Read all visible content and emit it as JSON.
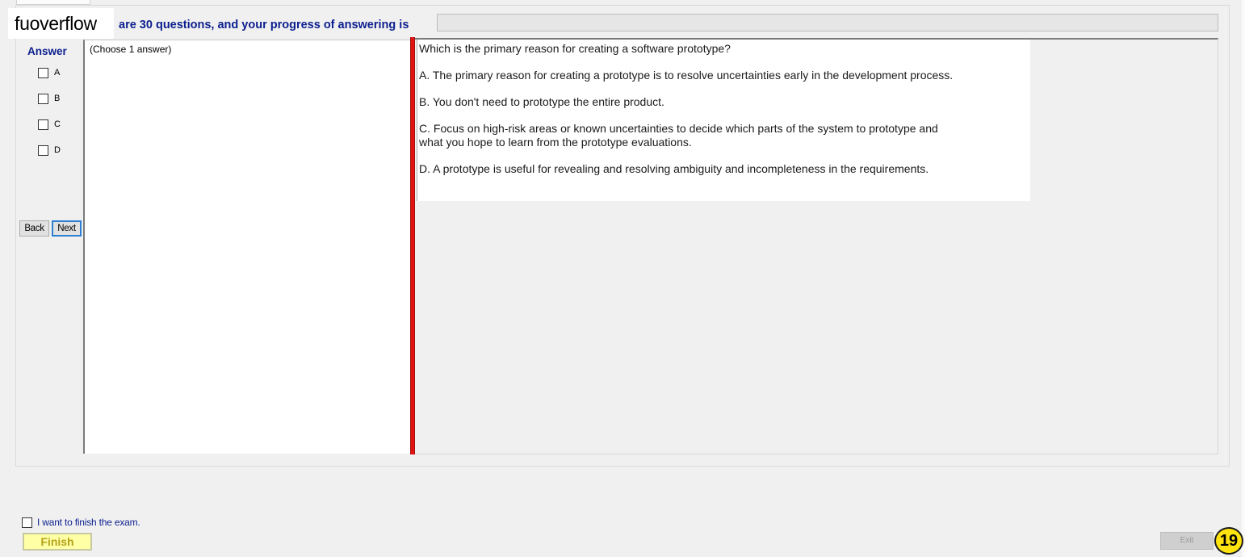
{
  "watermark": "fuoverflow",
  "header": {
    "progress_text": "are 30 questions, and your progress of answering is",
    "progress_value": 0
  },
  "answer_panel": {
    "title": "Answer",
    "options": [
      "A",
      "B",
      "C",
      "D"
    ],
    "back_label": "Back",
    "next_label": "Next"
  },
  "choose_text": "(Choose 1 answer)",
  "question": {
    "text": "Which is the primary reason for creating a software prototype?",
    "a": "A.  The primary reason for creating a prototype is to resolve uncertainties early in the development process.",
    "b": "B.  You don't need to prototype the entire product.",
    "c1": "C.  Focus on high-risk areas or known uncertainties to decide which parts of the system to prototype and",
    "c2": "what you hope to learn from the prototype evaluations.",
    "d": "D.  A prototype is useful for revealing and resolving ambiguity and incompleteness in the requirements."
  },
  "footer": {
    "finish_check_label": "I want to finish the exam.",
    "finish_label": "Finish",
    "exit_label": "Exit",
    "page_number": "19"
  },
  "colors": {
    "accent_text": "#0b1e8e",
    "splitter": "#e3130f",
    "finish_bg": "#ffffa6",
    "badge": "#ffe30f"
  }
}
